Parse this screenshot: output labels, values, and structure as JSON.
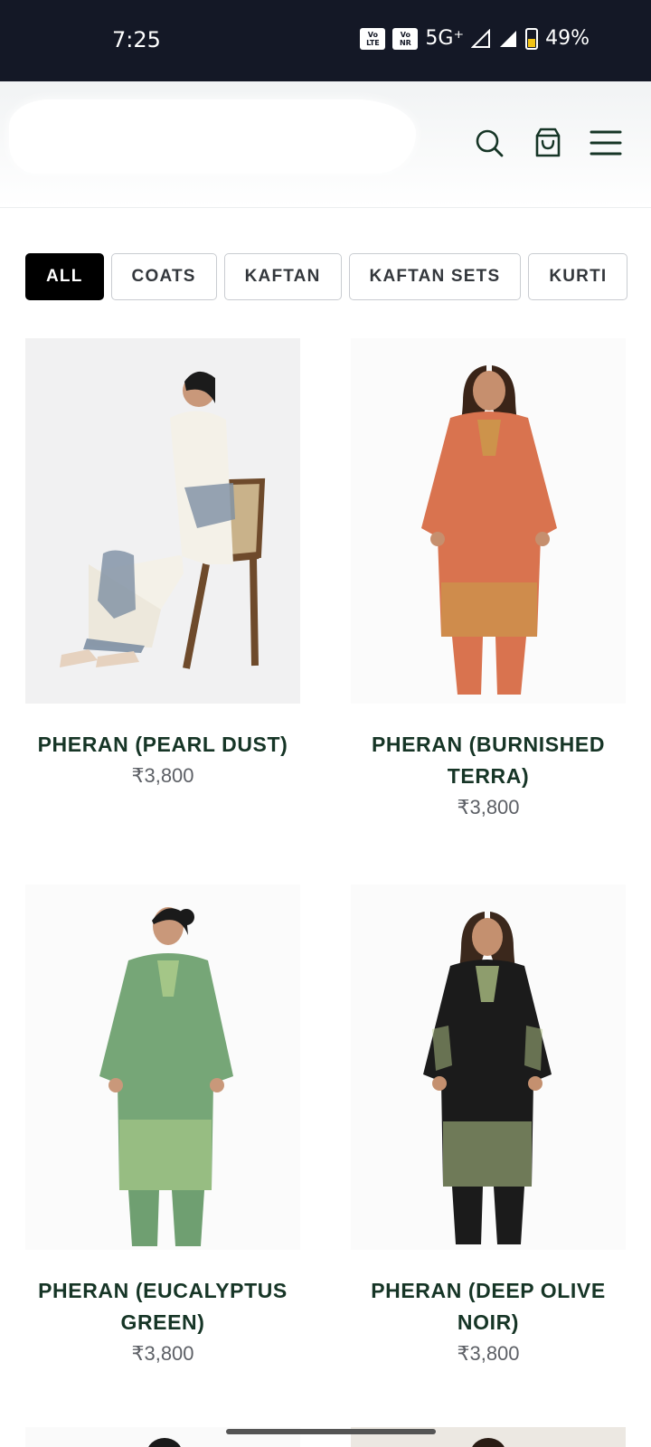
{
  "status_bar": {
    "time": "7:25",
    "sim1": {
      "line1": "Vo",
      "line2": "LTE",
      "slot": "2"
    },
    "sim2": {
      "line1": "Vo",
      "line2": "NR",
      "slot": "1"
    },
    "network": "5G⁺",
    "battery": "49%",
    "battery_level": 0.49
  },
  "header": {
    "icons": [
      "search-icon",
      "cart-icon",
      "menu-icon"
    ],
    "accent_color": "#163526"
  },
  "filters": [
    {
      "label": "ALL",
      "active": true
    },
    {
      "label": "COATS",
      "active": false
    },
    {
      "label": "KAFTAN",
      "active": false
    },
    {
      "label": "KAFTAN SETS",
      "active": false
    },
    {
      "label": "KURTI",
      "active": false
    }
  ],
  "products": [
    {
      "name": "PHERAN (PEARL DUST)",
      "price": "₹3,800",
      "color": "#efebe2"
    },
    {
      "name": "PHERAN (BURNISHED TERRA)",
      "price": "₹3,800",
      "color": "#d9734f"
    },
    {
      "name": "PHERAN (EUCALYPTUS GREEN)",
      "price": "₹3,800",
      "color": "#76a677"
    },
    {
      "name": "PHERAN (DEEP OLIVE NOIR)",
      "price": "₹3,800",
      "color": "#1b1b1b"
    }
  ]
}
